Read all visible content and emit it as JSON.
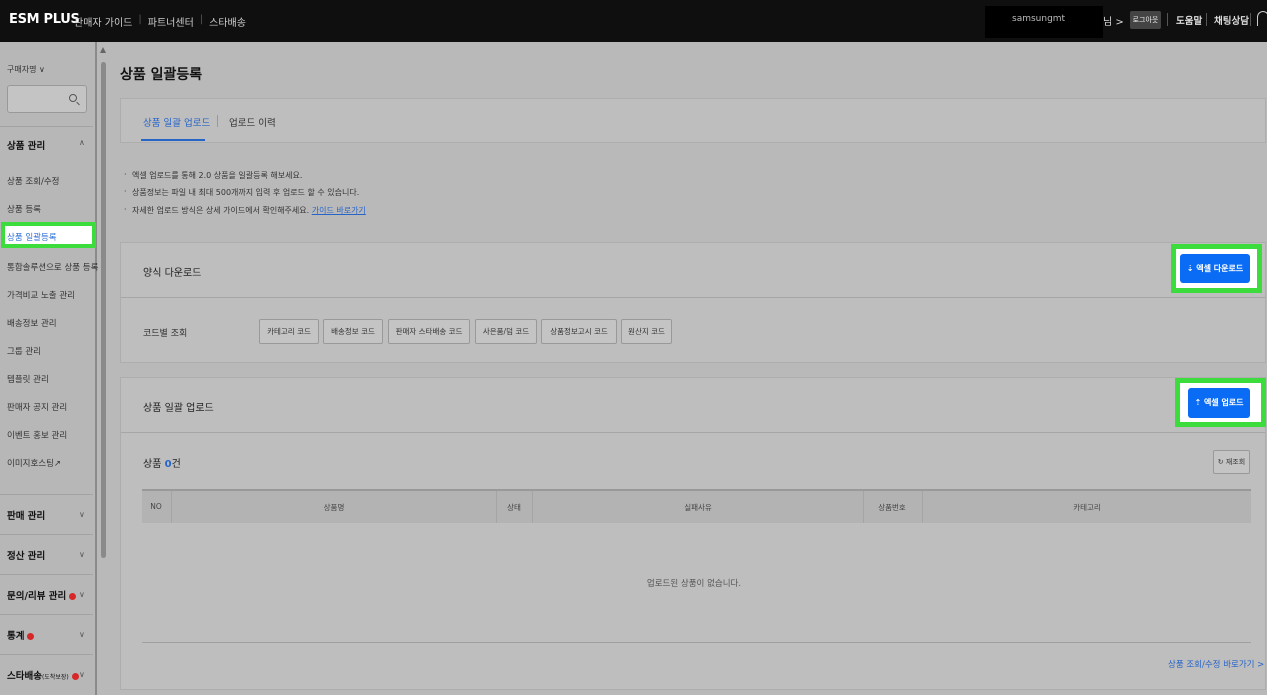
{
  "header": {
    "logo": "ESM PLUS",
    "links": [
      "판매자 가이드",
      "파트너센터",
      "스타배송"
    ],
    "user_name": "samsungmt",
    "user_suffix": "님 >",
    "logout": "로그아웃",
    "help": "도움말",
    "chat": "채팅상담"
  },
  "sidebar": {
    "buyer_name": "구매자명 ∨",
    "sections": [
      {
        "title": "상품 관리",
        "items": [
          "상품 조회/수정",
          "상품 등록",
          "상품 일괄등록",
          "통합솔루션으로 상품 등록",
          "가격비교 노출 관리",
          "배송정보 관리",
          "그룹 관리",
          "템플릿 관리",
          "판매자 공지 관리",
          "이벤트 홍보 관리",
          "이미지호스팅↗"
        ]
      },
      {
        "title": "판매 관리"
      },
      {
        "title": "정산 관리"
      },
      {
        "title": "문의/리뷰 관리"
      },
      {
        "title": "통계"
      },
      {
        "title": "스타배송",
        "sub": "(도착보장)"
      }
    ],
    "active_item": "상품 일괄등록"
  },
  "page": {
    "title": "상품 일괄등록",
    "tabs": [
      "상품 일괄 업로드",
      "업로드 이력"
    ],
    "notices": [
      "엑셀 업로드를 통해 2.0 상품을 일괄등록 해보세요.",
      "상품정보는 파일 내 최대 500개까지 입력 후 업로드 할 수 있습니다.",
      "자세한 업로드 방식은 상세 가이드에서 확인해주세요."
    ],
    "guide_link": "가이드 바로가기",
    "download": {
      "title": "양식 다운로드",
      "button": "⇣ 엑셀 다운로드",
      "code_label": "코드별 조회",
      "code_buttons": [
        "카테고리 코드",
        "배송정보 코드",
        "판매자 스타배송 코드",
        "사은품/덤 코드",
        "상품정보고시 코드",
        "원산지 코드"
      ]
    },
    "upload": {
      "title": "상품 일괄 업로드",
      "button": "⇡ 엑셀 업로드",
      "count_prefix": "상품 ",
      "count": "0",
      "count_suffix": "건",
      "reset": "↻ 재조회",
      "columns": [
        "NO",
        "상품명",
        "상태",
        "실패사유",
        "상품번호",
        "카테고리"
      ],
      "empty": "업로드된 상품이 없습니다.",
      "bottom_link": "상품 조회/수정 바로가기 >"
    }
  },
  "colors": {
    "accent": "#0a6cf5",
    "highlight": "#3bdc3b",
    "badge": "#d62828"
  }
}
